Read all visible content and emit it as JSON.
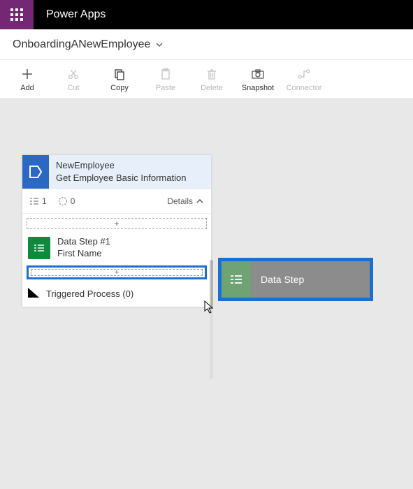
{
  "header": {
    "app_title": "Power Apps"
  },
  "breadcrumb": {
    "name": "OnboardingANewEmployee"
  },
  "toolbar": {
    "add": "Add",
    "cut": "Cut",
    "copy": "Copy",
    "paste": "Paste",
    "delete": "Delete",
    "snapshot": "Snapshot",
    "connector": "Connector"
  },
  "workflow": {
    "title": "NewEmployee",
    "subtitle": "Get Employee Basic Information",
    "count_list": "1",
    "count_pending": "0",
    "details_label": "Details",
    "slot_plus": "+",
    "data_step_title": "Data Step #1",
    "data_step_sub": "First Name",
    "active_plus": "+",
    "triggered_label": "Triggered Process (0)"
  },
  "drag": {
    "label": "Data Step"
  }
}
